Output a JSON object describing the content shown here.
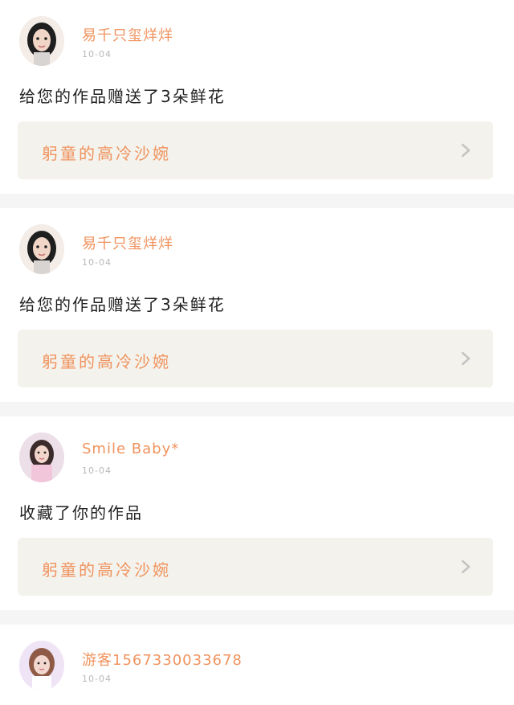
{
  "feed": {
    "items": [
      {
        "user_name": "易千只玺烊烊",
        "time": "10-04",
        "action": "给您的作品赠送了3朵鲜花",
        "work_title": "躬童的高冷沙婉"
      },
      {
        "user_name": "易千只玺烊烊",
        "time": "10-04",
        "action": "给您的作品赠送了3朵鲜花",
        "work_title": "躬童的高冷沙婉"
      },
      {
        "user_name": "Smile Baby*",
        "time": "10-04",
        "action": "收藏了你的作品",
        "work_title": "躬童的高冷沙婉"
      },
      {
        "user_name": "游客1567330033678",
        "time": "10-04"
      }
    ]
  },
  "colors": {
    "accent": "#f0935e",
    "card_box": "#f3f2ec",
    "separator": "#f5f5f5",
    "text": "#222222",
    "time": "#b8b8b8"
  },
  "icons": {
    "chevron": "chevron-right-icon"
  }
}
